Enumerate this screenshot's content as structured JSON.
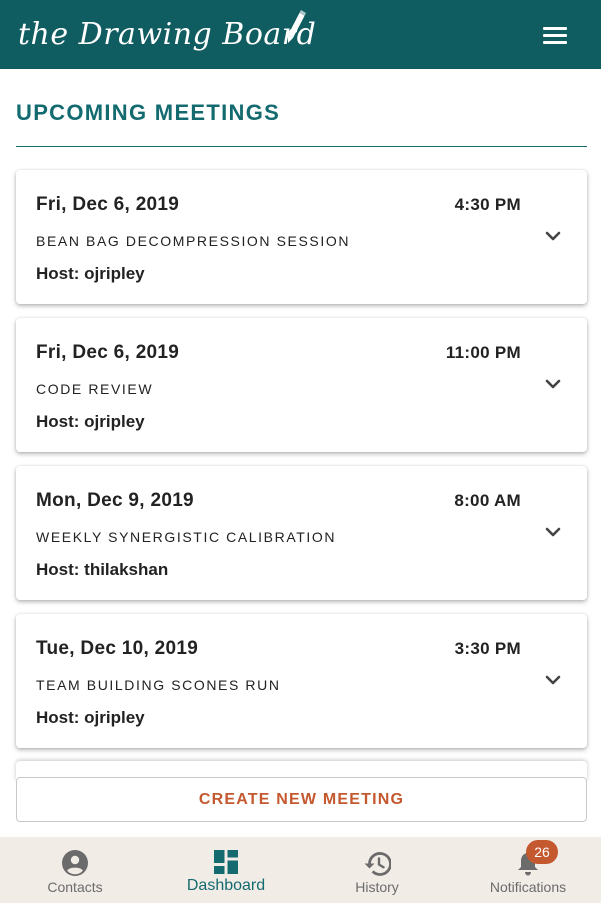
{
  "header": {
    "logo_text": "the Drawing Board",
    "menu_icon": "hamburger-menu-icon",
    "brand_color": "#0f5c61"
  },
  "main": {
    "title": "UPCOMING MEETINGS",
    "meetings": [
      {
        "date": "Fri, Dec 6, 2019",
        "time": "4:30 PM",
        "name": "BEAN BAG DECOMPRESSION SESSION",
        "host": "Host: ojripley"
      },
      {
        "date": "Fri, Dec 6, 2019",
        "time": "11:00 PM",
        "name": "CODE REVIEW",
        "host": "Host: ojripley"
      },
      {
        "date": "Mon, Dec 9, 2019",
        "time": "8:00 AM",
        "name": "WEEKLY SYNERGISTIC CALIBRATION",
        "host": "Host: thilakshan"
      },
      {
        "date": "Tue, Dec 10, 2019",
        "time": "3:30 PM",
        "name": "TEAM BUILDING SCONES RUN",
        "host": "Host: ojripley"
      }
    ],
    "create_button_label": "CREATE NEW MEETING",
    "accent_color": "#c4582e"
  },
  "bottom_nav": {
    "items": [
      {
        "label": "Contacts",
        "icon": "account-circle-icon"
      },
      {
        "label": "Dashboard",
        "icon": "dashboard-icon"
      },
      {
        "label": "History",
        "icon": "history-icon"
      },
      {
        "label": "Notifications",
        "icon": "bell-icon"
      }
    ],
    "active": "Dashboard",
    "notification_count": "26"
  }
}
